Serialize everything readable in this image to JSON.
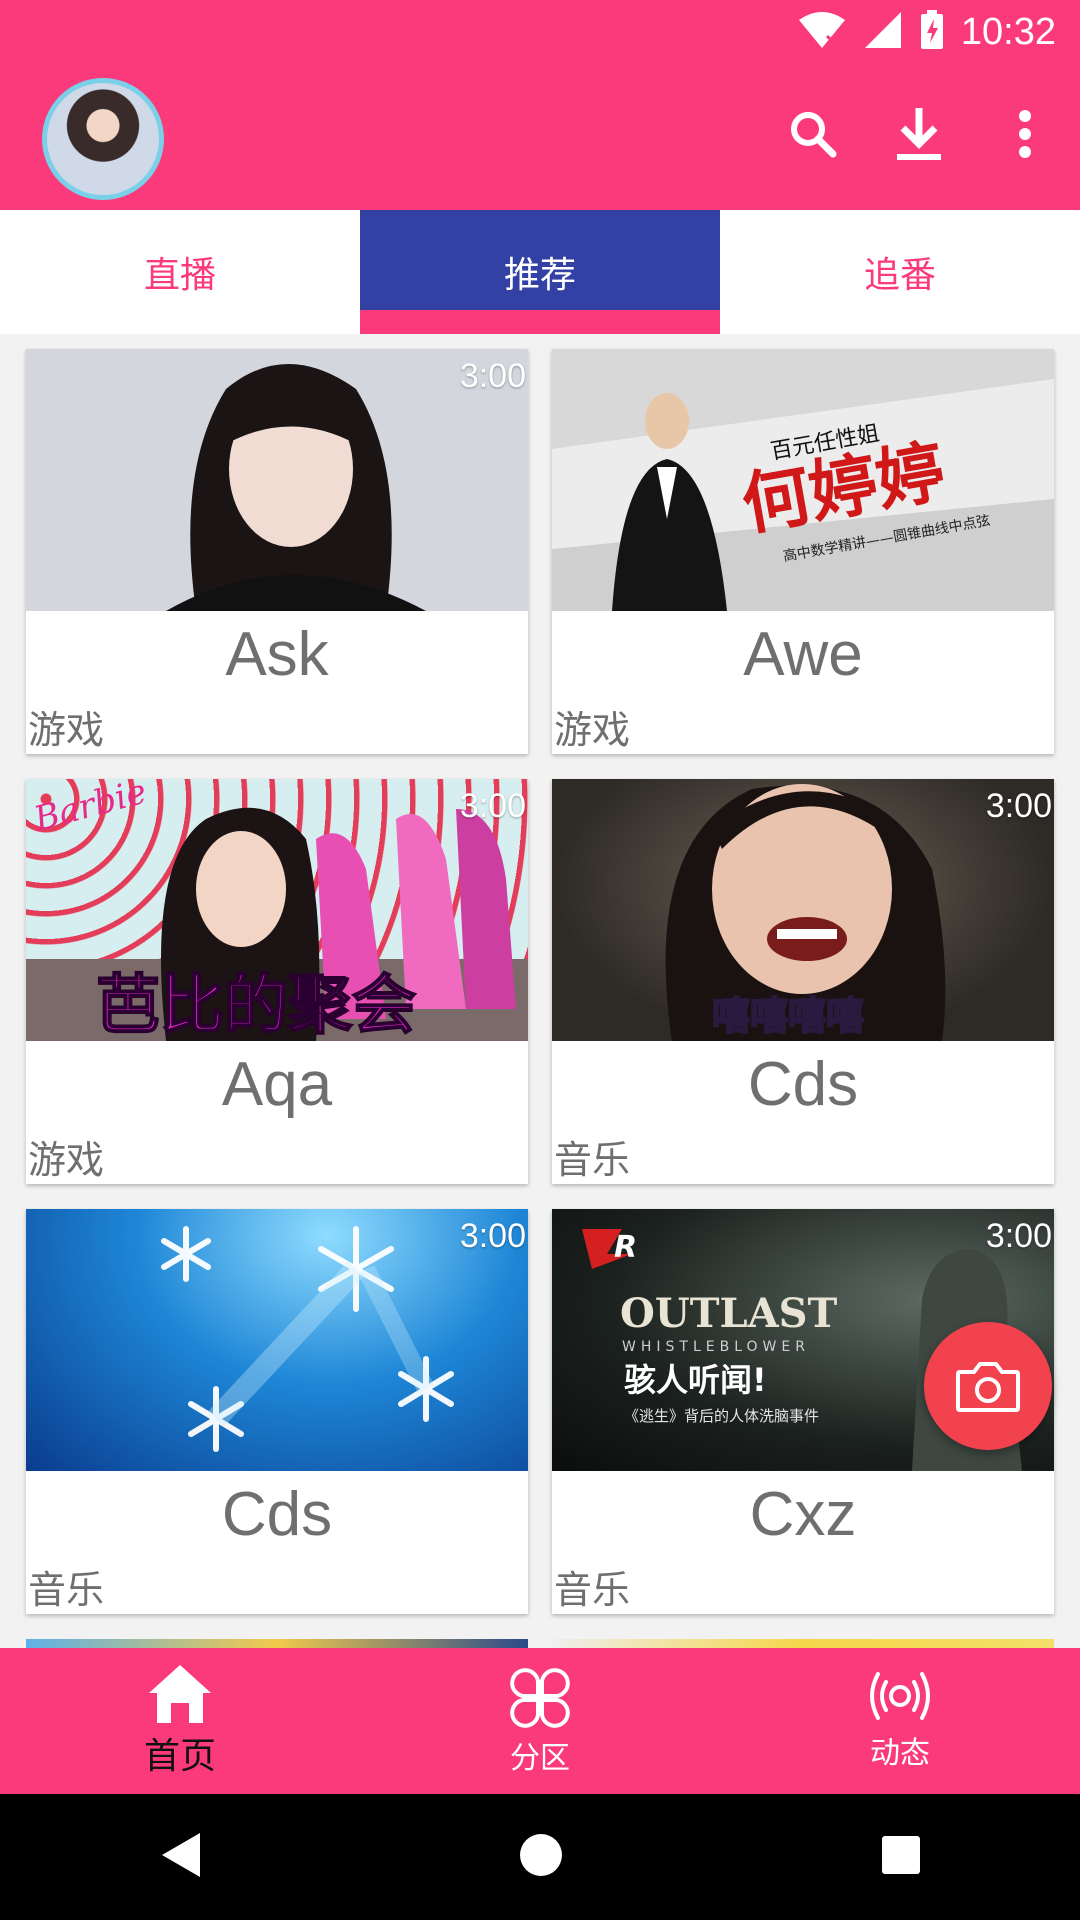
{
  "status_bar": {
    "time": "10:32"
  },
  "tabs": [
    {
      "label": "直播",
      "active": false
    },
    {
      "label": "推荐",
      "active": true
    },
    {
      "label": "追番",
      "active": false
    }
  ],
  "cards": [
    {
      "title": "Ask",
      "category": "游戏",
      "duration": "3:00"
    },
    {
      "title": "Awe",
      "category": "游戏",
      "duration": "",
      "thumb_text_1": "百元任性姐",
      "thumb_text_2": "何婷婷",
      "thumb_text_3": "高中数学精讲——圆锥曲线中点弦"
    },
    {
      "title": "Aqa",
      "category": "游戏",
      "duration": "3:00",
      "thumb_text_1": "Barbie",
      "thumb_text_2": "芭比的聚会"
    },
    {
      "title": "Cds",
      "category": "音乐",
      "duration": "3:00",
      "thumb_text_1": "嘻嘻嘻嘻"
    },
    {
      "title": "Cds",
      "category": "音乐",
      "duration": "3:00"
    },
    {
      "title": "Cxz",
      "category": "音乐",
      "duration": "3:00",
      "thumb_text_1": "OUTLAST",
      "thumb_text_2": "WHISTLEBLOWER",
      "thumb_text_3": "骇人听闻!",
      "thumb_text_4": "《逃生》背后的人体洗脑事件"
    }
  ],
  "bottom_nav": [
    {
      "label": "首页",
      "icon": "home-icon",
      "active": true
    },
    {
      "label": "分区",
      "icon": "grid-icon",
      "active": false
    },
    {
      "label": "动态",
      "icon": "broadcast-icon",
      "active": false
    }
  ],
  "colors": {
    "primary": "#fb3a7b",
    "tab_active": "#3341a4",
    "fab": "#f2424e"
  }
}
